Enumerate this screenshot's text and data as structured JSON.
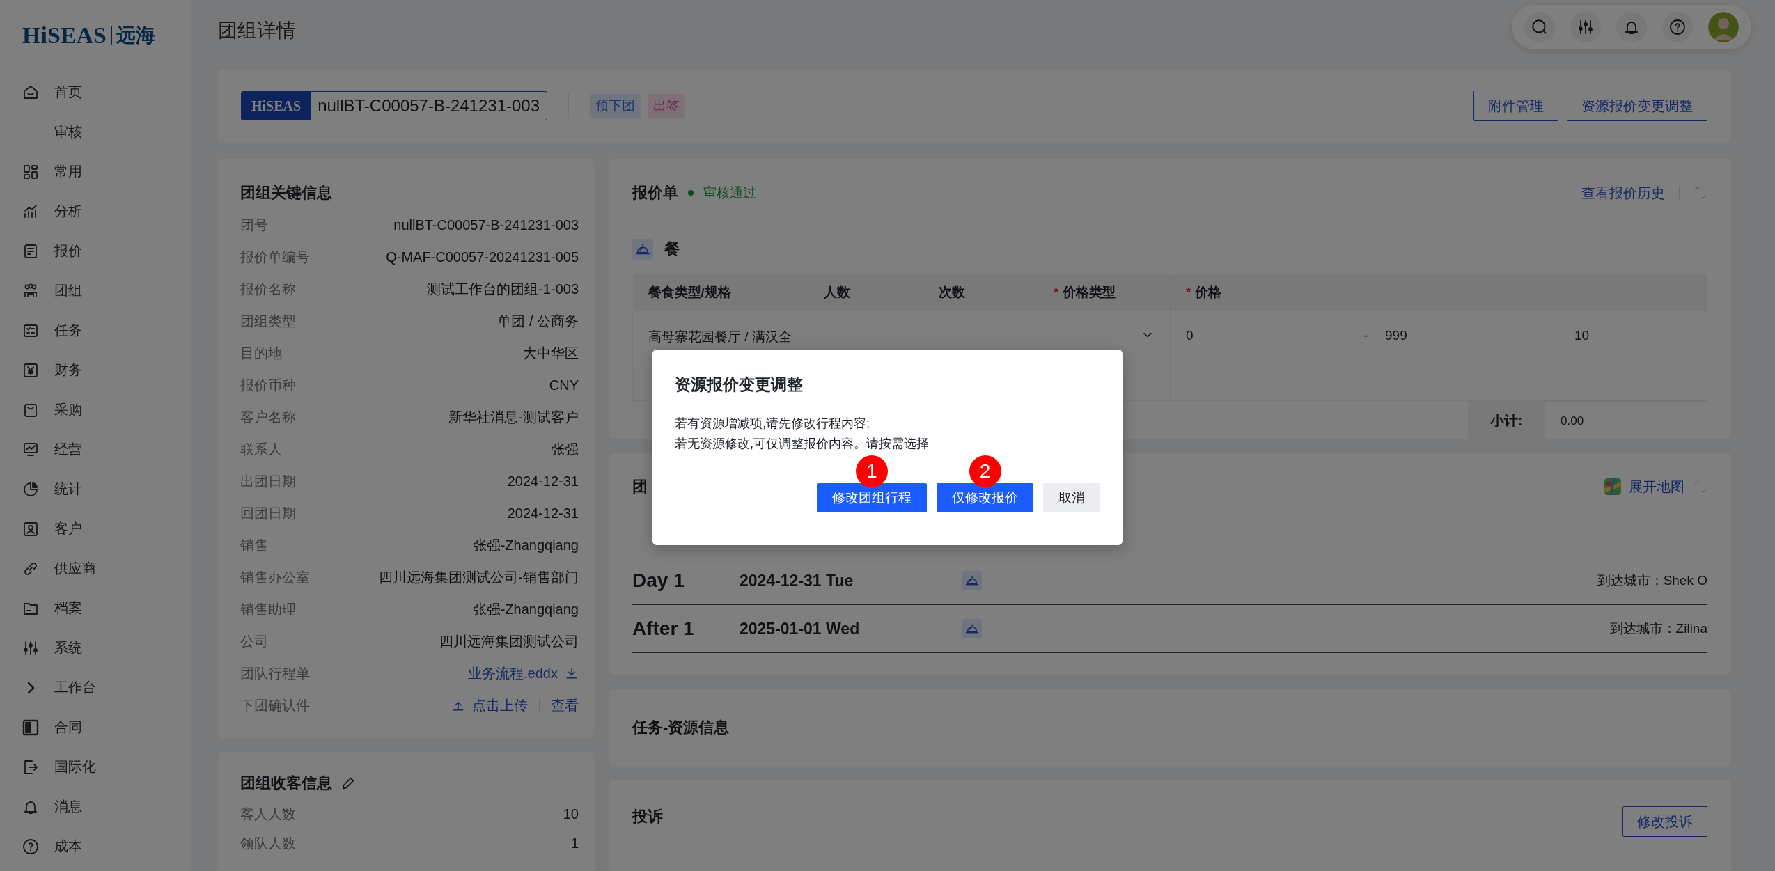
{
  "sidebar": {
    "logo": {
      "brand": "HiSEAS",
      "name": "远海"
    },
    "items": [
      {
        "label": "首页"
      },
      {
        "label": "审核"
      },
      {
        "label": "常用"
      },
      {
        "label": "分析"
      },
      {
        "label": "报价"
      },
      {
        "label": "团组"
      },
      {
        "label": "任务"
      },
      {
        "label": "财务"
      },
      {
        "label": "采购"
      },
      {
        "label": "经营"
      },
      {
        "label": "统计"
      },
      {
        "label": "客户"
      },
      {
        "label": "供应商"
      },
      {
        "label": "档案"
      },
      {
        "label": "系统"
      },
      {
        "label": "工作台"
      },
      {
        "label": "合同"
      },
      {
        "label": "国际化"
      },
      {
        "label": "消息"
      },
      {
        "label": "成本"
      }
    ]
  },
  "header": {
    "title": "团组详情"
  },
  "group_bar": {
    "logo": "HiSEAS",
    "code": "nullBT-C00057-B-241231-003",
    "tags": [
      {
        "label": "预下团",
        "kind": "info"
      },
      {
        "label": "出签",
        "kind": "visa"
      }
    ],
    "buttons": [
      "附件管理",
      "资源报价变更调整"
    ]
  },
  "key_info": {
    "title": "团组关键信息",
    "rows": [
      {
        "kind": "text",
        "label": "团号",
        "value": "nullBT-C00057-B-241231-003"
      },
      {
        "kind": "text",
        "label": "报价单编号",
        "value": "Q-MAF-C00057-20241231-005"
      },
      {
        "kind": "text",
        "label": "报价名称",
        "value": "测试工作台的团组-1-003"
      },
      {
        "kind": "text",
        "label": "团组类型",
        "value": "单团 / 公商务"
      },
      {
        "kind": "text",
        "label": "目的地",
        "value": "大中华区"
      },
      {
        "kind": "text",
        "label": "报价币种",
        "value": "CNY"
      },
      {
        "kind": "text",
        "label": "客户名称",
        "value": "新华社消息-测试客户"
      },
      {
        "kind": "text",
        "label": "联系人",
        "value": "张强"
      },
      {
        "kind": "text",
        "label": "出团日期",
        "value": "2024-12-31"
      },
      {
        "kind": "text",
        "label": "回团日期",
        "value": "2024-12-31"
      },
      {
        "kind": "text",
        "label": "销售",
        "value": "张强-Zhangqiang"
      },
      {
        "kind": "text",
        "label": "销售办公室",
        "value": "四川远海集团测试公司-销售部门"
      },
      {
        "kind": "text",
        "label": "销售助理",
        "value": "张强-Zhangqiang"
      },
      {
        "kind": "text",
        "label": "公司",
        "value": "四川远海集团测试公司"
      },
      {
        "kind": "download",
        "label": "团队行程单",
        "value": "业务流程.eddx"
      },
      {
        "kind": "upload",
        "label": "下团确认件",
        "value": "点击上传",
        "action": "查看"
      }
    ]
  },
  "guest_info": {
    "title": "团组收客信息",
    "rows": [
      {
        "label": "客人人数",
        "value": "10"
      },
      {
        "label": "领队人数",
        "value": "1"
      }
    ]
  },
  "quote": {
    "title": "报价单",
    "status": "审核通过",
    "history_link": "查看报价历史",
    "section": "餐",
    "required_mark": "*",
    "columns": [
      {
        "label": "餐食类型/规格",
        "required": false
      },
      {
        "label": "人数",
        "required": false
      },
      {
        "label": "次数",
        "required": false
      },
      {
        "label": "价格类型",
        "required": true
      },
      {
        "label": "价格",
        "required": true
      }
    ],
    "row": {
      "meal": "高母寨花园餐厅 / 满汉全",
      "price_min": "0",
      "separator": "-",
      "price_max": "999",
      "price": "10"
    },
    "subtotal_label": "小计:",
    "subtotal": "0.00"
  },
  "itinerary": {
    "title": "团",
    "map_link": "展开地图",
    "days": [
      {
        "day": "Day 1",
        "date": "2024-12-31 Tue",
        "city": "到达城市：Shek O"
      },
      {
        "day": "After 1",
        "date": "2025-01-01 Wed",
        "city": "到达城市：Zilina"
      }
    ]
  },
  "tasks": {
    "title": "任务-资源信息"
  },
  "complaint": {
    "title": "投诉",
    "button": "修改投诉"
  },
  "modal": {
    "title": "资源报价变更调整",
    "lines": [
      "若有资源增减项,请先修改行程内容;",
      "若无资源修改,可仅调整报价内容。请按需选择"
    ],
    "buttons": [
      {
        "label": "修改团组行程",
        "kind": "primary",
        "badge": "1"
      },
      {
        "label": "仅修改报价",
        "kind": "primary",
        "badge": "2"
      },
      {
        "label": "取消",
        "kind": "secondary"
      }
    ]
  }
}
